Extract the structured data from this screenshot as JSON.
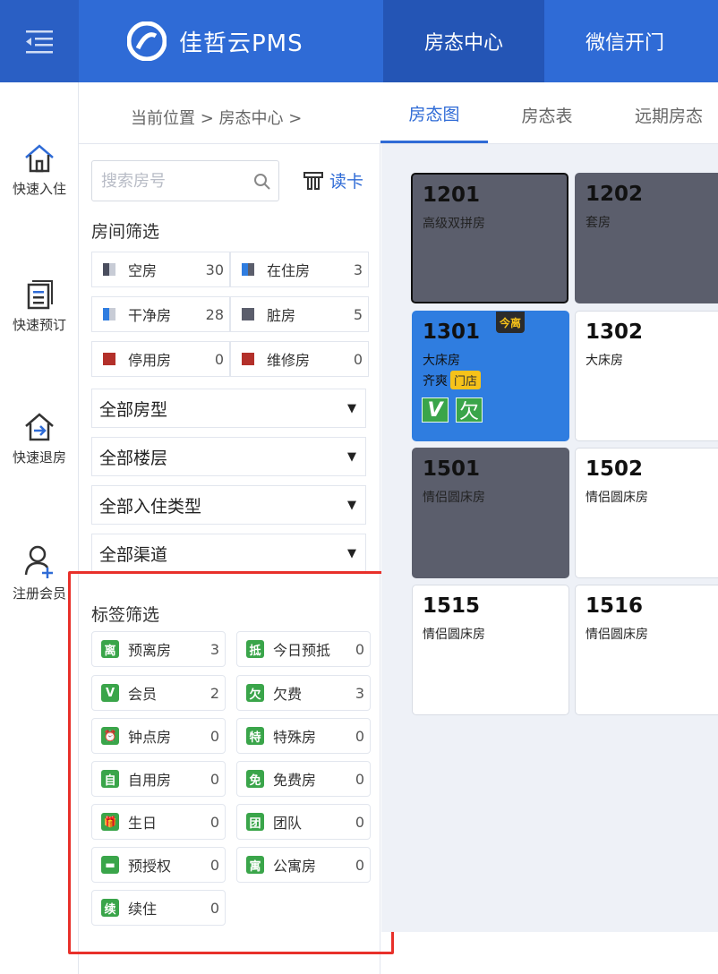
{
  "header": {
    "brand": "佳哲云PMS",
    "nav": [
      {
        "label": "房态中心",
        "active": true
      },
      {
        "label": "微信开门",
        "active": false
      }
    ]
  },
  "rail": [
    {
      "label": "快速入住",
      "icon": "home-icon"
    },
    {
      "label": "快速预订",
      "icon": "clipboard-icon"
    },
    {
      "label": "快速退房",
      "icon": "exit-home-icon"
    },
    {
      "label": "注册会员",
      "icon": "add-user-icon"
    }
  ],
  "breadcrumb": "当前位置  >  房态中心  >",
  "subtabs": [
    {
      "label": "房态图",
      "active": true
    },
    {
      "label": "房态表",
      "active": false
    },
    {
      "label": "远期房态",
      "active": false
    }
  ],
  "search": {
    "placeholder": "搜索房号",
    "read_card": "读卡"
  },
  "room_filter": {
    "title": "房间筛选",
    "items": [
      {
        "label": "空房",
        "count": "30",
        "color": "#4a4e5e"
      },
      {
        "label": "在住房",
        "count": "3",
        "color": "#2f7de0"
      },
      {
        "label": "干净房",
        "count": "28",
        "color": "#2f7de0"
      },
      {
        "label": "脏房",
        "count": "5",
        "color": "#5b5e6c"
      },
      {
        "label": "停用房",
        "count": "0",
        "color": "#b3302a"
      },
      {
        "label": "维修房",
        "count": "0",
        "color": "#b3302a"
      }
    ]
  },
  "dropdowns": [
    "全部房型",
    "全部楼层",
    "全部入住类型",
    "全部渠道"
  ],
  "tag_filter": {
    "title": "标签筛选",
    "items": [
      {
        "label": "预离房",
        "count": "3",
        "glyph": "离"
      },
      {
        "label": "今日预抵",
        "count": "0",
        "glyph": "抵"
      },
      {
        "label": "会员",
        "count": "2",
        "glyph": "V"
      },
      {
        "label": "欠费",
        "count": "3",
        "glyph": "欠"
      },
      {
        "label": "钟点房",
        "count": "0",
        "glyph": "⏰"
      },
      {
        "label": "特殊房",
        "count": "0",
        "glyph": "特"
      },
      {
        "label": "自用房",
        "count": "0",
        "glyph": "自"
      },
      {
        "label": "免费房",
        "count": "0",
        "glyph": "免"
      },
      {
        "label": "生日",
        "count": "0",
        "glyph": "🎁"
      },
      {
        "label": "团队",
        "count": "0",
        "glyph": "团"
      },
      {
        "label": "预授权",
        "count": "0",
        "glyph": "▬"
      },
      {
        "label": "公寓房",
        "count": "0",
        "glyph": "寓"
      },
      {
        "label": "续住",
        "count": "0",
        "glyph": "续"
      }
    ]
  },
  "rooms": [
    {
      "number": "1201",
      "type": "高级双拼房",
      "state": "dirty"
    },
    {
      "number": "1202",
      "type": "套房",
      "state": "dirty"
    },
    {
      "number": "1301",
      "type": "大床房",
      "state": "occupied",
      "guest": "齐爽",
      "source": "门店",
      "badge": "今离",
      "flags": [
        "V",
        "欠"
      ]
    },
    {
      "number": "1302",
      "type": "大床房",
      "state": "vacant"
    },
    {
      "number": "1501",
      "type": "情侣圆床房",
      "state": "dirty"
    },
    {
      "number": "1502",
      "type": "情侣圆床房",
      "state": "vacant"
    },
    {
      "number": "1515",
      "type": "情侣圆床房",
      "state": "vacant"
    },
    {
      "number": "1516",
      "type": "情侣圆床房",
      "state": "vacant"
    }
  ]
}
